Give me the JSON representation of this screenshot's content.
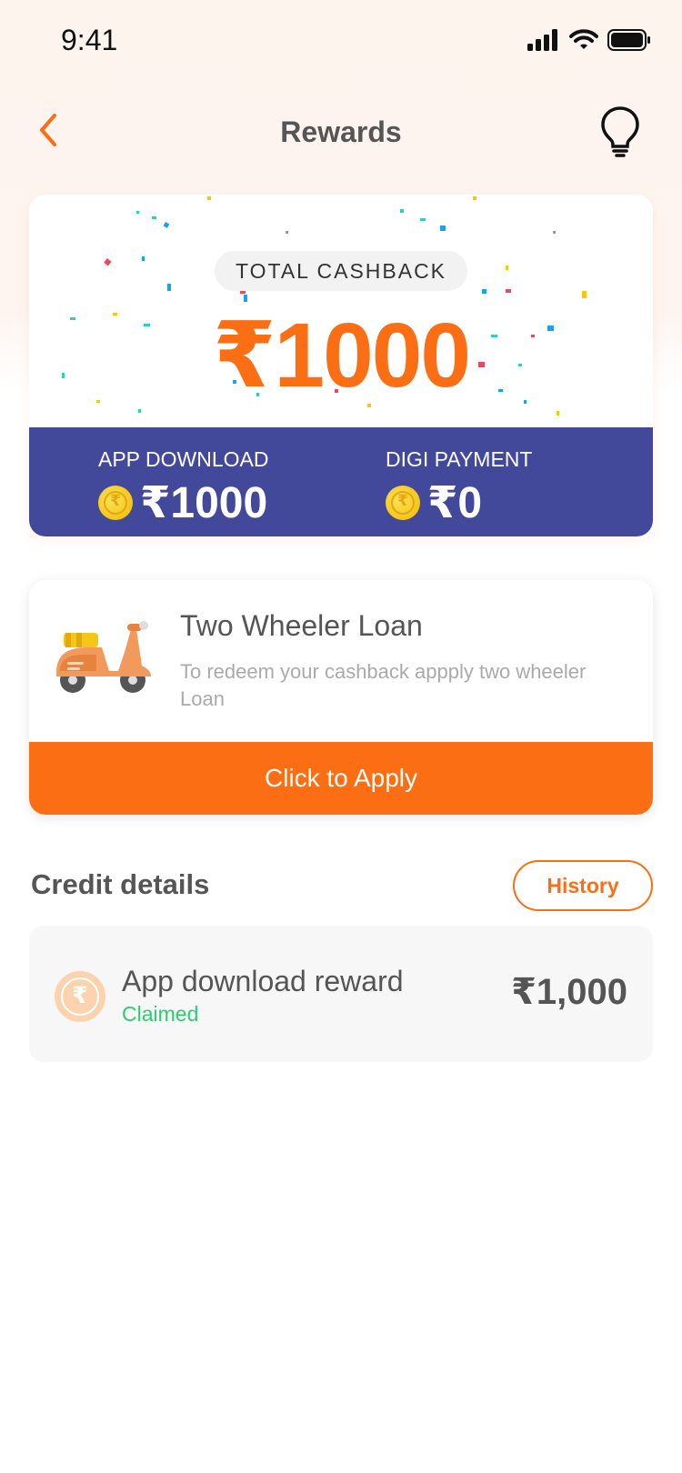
{
  "status_bar": {
    "time": "9:41"
  },
  "nav": {
    "title": "Rewards",
    "back_icon": "chevron-left-icon",
    "tips_icon": "lightbulb-icon"
  },
  "cashback": {
    "label": "TOTAL CASHBACK",
    "amount": "₹1000",
    "app_download": {
      "label": "APP DOWNLOAD",
      "amount": "₹1000"
    },
    "digi_payment": {
      "label": "DIGI PAYMENT",
      "amount": "₹0"
    },
    "coin_glyph": "₹"
  },
  "loan": {
    "title": "Two Wheeler Loan",
    "description": "To redeem your cashback appply two wheeler Loan",
    "cta": "Click to Apply"
  },
  "credit": {
    "title": "Credit details",
    "history_label": "History",
    "items": [
      {
        "name": "App download reward",
        "status": "Claimed",
        "amount": "₹1,000",
        "icon_glyph": "₹"
      }
    ]
  },
  "colors": {
    "accent": "#fb6e13",
    "banner": "#42489a",
    "success": "#2ecc71"
  }
}
